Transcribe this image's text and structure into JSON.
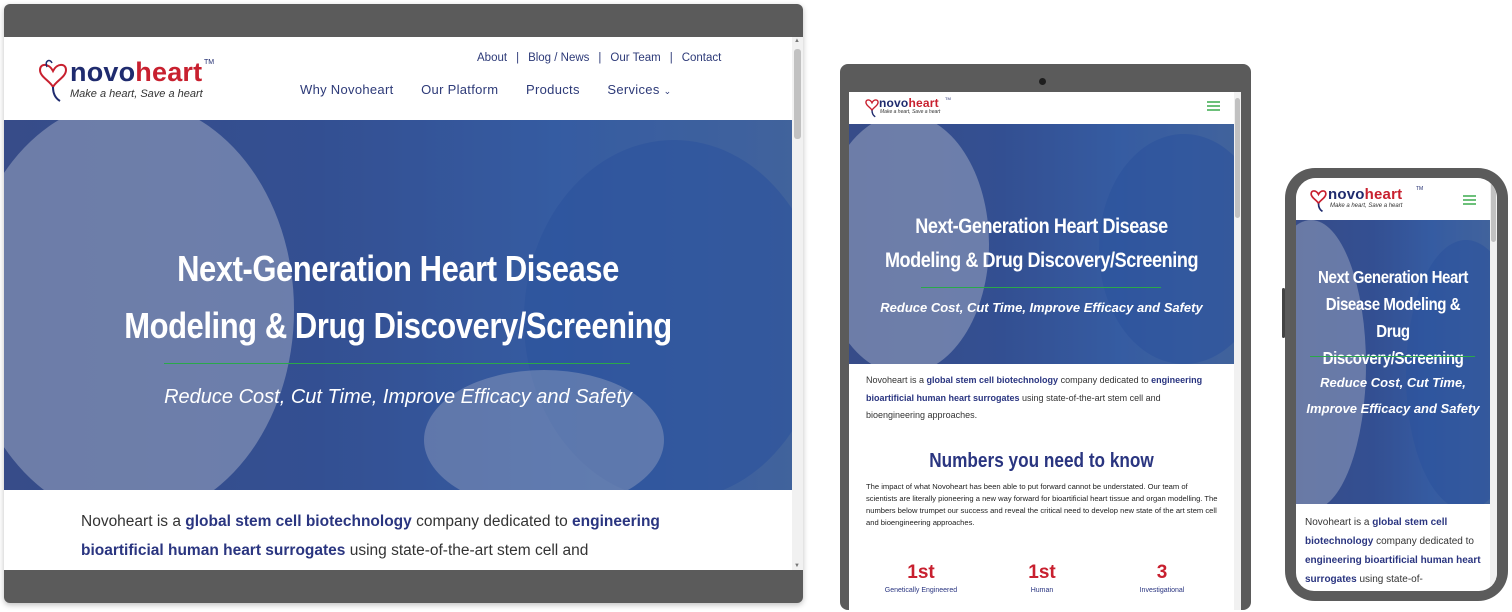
{
  "brand": {
    "name_part1": "novo",
    "name_part2": "heart",
    "tm": "TM",
    "tagline": "Make a heart, Save a heart",
    "colors": {
      "navy": "#1f2b6e",
      "red": "#c8202f",
      "green": "#2aa84a"
    }
  },
  "desktop": {
    "top_nav": [
      "About",
      "Blog / News",
      "Our Team",
      "Contact"
    ],
    "separator": "|",
    "main_nav": [
      "Why Novoheart",
      "Our Platform",
      "Products",
      "Services"
    ],
    "services_chevron": "⌄",
    "hero": {
      "title_line1": "Next-Generation Heart Disease",
      "title_line2": "Modeling & Drug Discovery/Screening",
      "subtitle": "Reduce Cost, Cut Time, Improve Efficacy and Safety"
    },
    "intro": {
      "t1": "Novoheart is a ",
      "b1": "global stem cell biotechnology",
      "t2": " company dedicated to ",
      "b2": "engineering bioartificial human heart surrogates",
      "t3": " using state-of-the-art stem cell and"
    }
  },
  "tablet": {
    "hero": {
      "title_line1": "Next-Generation Heart Disease",
      "title_line2": "Modeling & Drug Discovery/Screening",
      "subtitle": "Reduce Cost, Cut Time, Improve Efficacy and Safety"
    },
    "intro": {
      "t1": "Novoheart is a ",
      "b1": "global stem cell biotechnology",
      "t2": " company dedicated to ",
      "b2": "engineering bioartificial human heart surrogates",
      "t3": " using state-of-the-art stem cell and bioengineering approaches."
    },
    "numbers_title": "Numbers you need to know",
    "numbers_text": "The impact of what Novoheart has been able to put forward cannot be understated. Our team of scientists are literally pioneering a new way forward for bioartificial heart tissue and organ modelling. The numbers below trumpet our success and reveal the critical need to develop new state of the art stem cell and bioengineering approaches.",
    "stats": [
      {
        "value": "1st",
        "label": "Genetically Engineered"
      },
      {
        "value": "1st",
        "label": "Human"
      },
      {
        "value": "3",
        "label": "Investigational"
      }
    ]
  },
  "phone": {
    "hero": {
      "title_line1": "Next Generation Heart",
      "title_line2": "Disease Modeling & Drug",
      "title_line3": "Discovery/Screening",
      "subtitle": "Reduce Cost, Cut Time, Improve Efficacy and Safety"
    },
    "intro": {
      "t1": "Novoheart is a ",
      "b1": "global stem cell biotechnology",
      "t2": " company dedicated to ",
      "b2": "engineering bioartificial human heart surrogates",
      "t3": " using state-of-"
    }
  },
  "icons": {
    "logo": "heart-outline-icon",
    "menu": "hamburger-menu-icon",
    "scroll_up": "▲",
    "scroll_down": "▼"
  }
}
